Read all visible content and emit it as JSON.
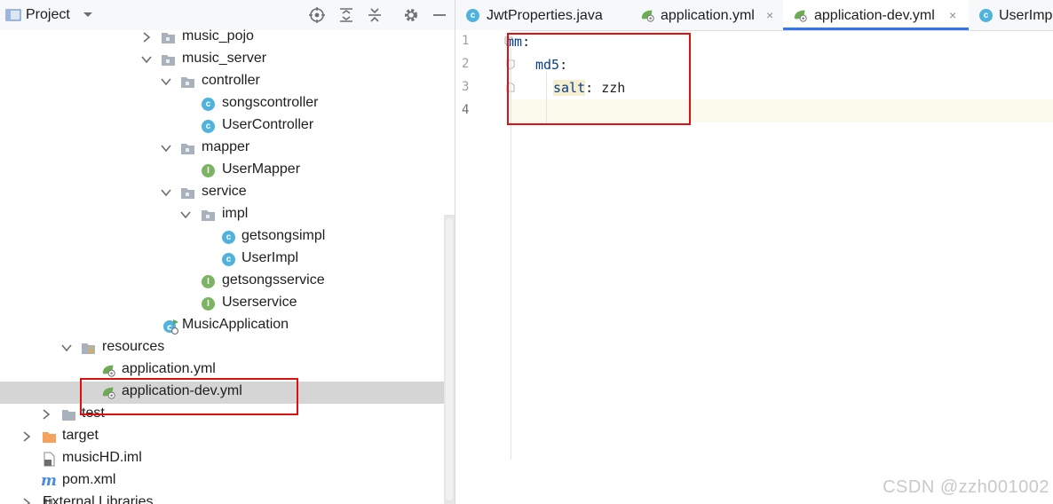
{
  "project_panel": {
    "title": "Project",
    "toolbar_icons": [
      "target-icon",
      "expand-all-icon",
      "collapse-all-icon",
      "gear-icon",
      "minimize-icon"
    ],
    "tree": [
      {
        "label": "music_pojo",
        "type": "package",
        "expanded": false
      },
      {
        "label": "music_server",
        "type": "package",
        "expanded": true
      },
      {
        "label": "controller",
        "type": "package",
        "expanded": true
      },
      {
        "label": "songscontroller",
        "type": "class"
      },
      {
        "label": "UserController",
        "type": "class"
      },
      {
        "label": "mapper",
        "type": "package",
        "expanded": true
      },
      {
        "label": "UserMapper",
        "type": "interface"
      },
      {
        "label": "service",
        "type": "package",
        "expanded": true
      },
      {
        "label": "impl",
        "type": "package",
        "expanded": true
      },
      {
        "label": "getsongsimpl",
        "type": "class"
      },
      {
        "label": "UserImpl",
        "type": "class"
      },
      {
        "label": "getsongsservice",
        "type": "interface"
      },
      {
        "label": "Userservice",
        "type": "interface"
      },
      {
        "label": "MusicApplication",
        "type": "spring-class"
      },
      {
        "label": "resources",
        "type": "resources-folder",
        "expanded": true
      },
      {
        "label": "application.yml",
        "type": "yml"
      },
      {
        "label": "application-dev.yml",
        "type": "yml",
        "selected": true
      },
      {
        "label": "test",
        "type": "folder",
        "expanded": false
      },
      {
        "label": "target",
        "type": "excluded-folder",
        "expanded": false
      },
      {
        "label": "musicHD.iml",
        "type": "iml"
      },
      {
        "label": "pom.xml",
        "type": "maven"
      },
      {
        "label": "External Libraries",
        "type": "libraries",
        "expanded": false
      }
    ]
  },
  "editor": {
    "tabs": [
      {
        "label": "JwtProperties.java",
        "type": "class",
        "active": false,
        "closable": false
      },
      {
        "label": "application.yml",
        "type": "yml",
        "active": false,
        "closable": true
      },
      {
        "label": "application-dev.yml",
        "type": "yml",
        "active": true,
        "closable": true
      },
      {
        "label": "UserImp",
        "type": "class",
        "active": false,
        "closable": false
      }
    ],
    "close_glyph": "×",
    "line_numbers": [
      "1",
      "2",
      "3",
      "4"
    ],
    "code": {
      "l1_key": "mm",
      "l1_colon": ":",
      "l2_key": "md5",
      "l2_colon": ":",
      "l3_key": "salt",
      "l3_colon": ":",
      "l3_value": "zzh"
    }
  },
  "watermark": "CSDN @zzh001002",
  "colors": {
    "highlight_box": "#e01010",
    "active_tab_underline": "#3574f0",
    "yaml_key": "#0a3e8a",
    "selection": "#d5d5d5"
  }
}
